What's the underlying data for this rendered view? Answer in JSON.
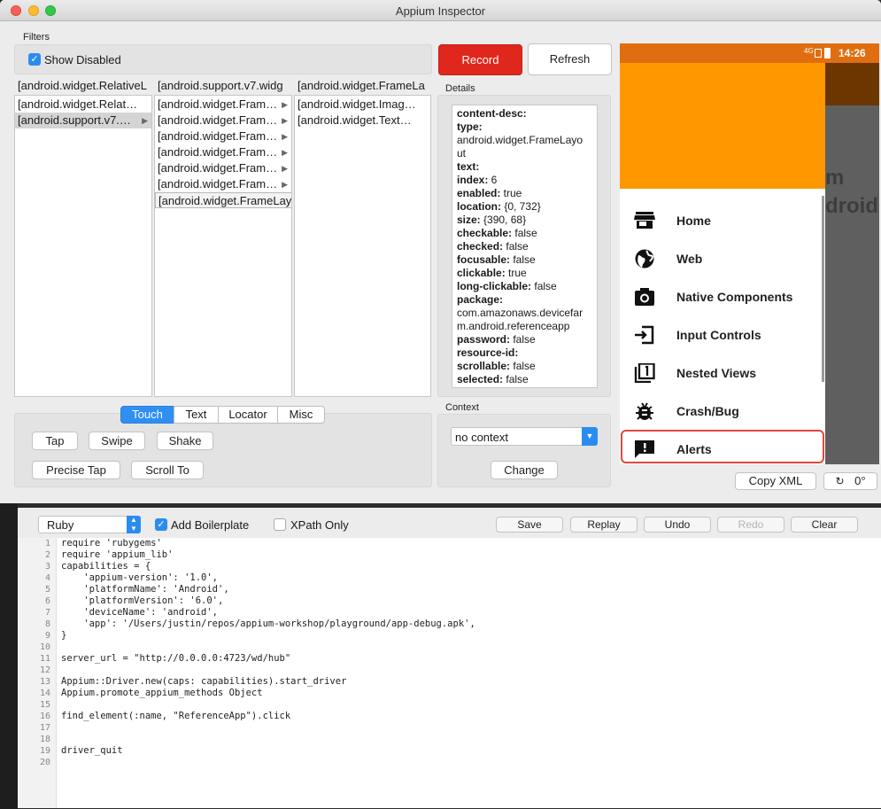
{
  "window": {
    "title": "Appium Inspector"
  },
  "filters": {
    "label": "Filters",
    "show_disabled_label": "Show Disabled"
  },
  "tree": {
    "columns": [
      {
        "header": "[android.widget.RelativeL",
        "items": [
          {
            "label": "[android.widget.Relat…",
            "arrow": false,
            "selected": false
          },
          {
            "label": "[android.support.v7.…",
            "arrow": true,
            "selected": true
          }
        ]
      },
      {
        "header": "[android.support.v7.widg",
        "items": [
          {
            "label": "[android.widget.Fram…",
            "arrow": true
          },
          {
            "label": "[android.widget.Fram…",
            "arrow": true
          },
          {
            "label": "[android.widget.Fram…",
            "arrow": true
          },
          {
            "label": "[android.widget.Fram…",
            "arrow": true
          },
          {
            "label": "[android.widget.Fram…",
            "arrow": true
          },
          {
            "label": "[android.widget.Fram…",
            "arrow": true
          },
          {
            "label": "[android.widget.FrameLayout]",
            "arrow": false,
            "selected": true
          }
        ]
      },
      {
        "header": "[android.widget.FrameLa",
        "items": [
          {
            "label": "[android.widget.Imag…",
            "arrow": false
          },
          {
            "label": "[android.widget.Text…",
            "arrow": false
          }
        ]
      }
    ]
  },
  "toolbar": {
    "record_label": "Record",
    "refresh_label": "Refresh"
  },
  "details": {
    "label": "Details",
    "rows": [
      {
        "key": "content-desc:",
        "value": ""
      },
      {
        "key": "type:",
        "value": ""
      },
      {
        "key": "",
        "value": "android.widget.FrameLayo"
      },
      {
        "key": "",
        "value": "ut"
      },
      {
        "key": "text:",
        "value": ""
      },
      {
        "key": "index:",
        "value": " 6"
      },
      {
        "key": "enabled:",
        "value": " true"
      },
      {
        "key": "location:",
        "value": " {0, 732}"
      },
      {
        "key": "size:",
        "value": " {390, 68}"
      },
      {
        "key": "checkable:",
        "value": " false"
      },
      {
        "key": "checked:",
        "value": " false"
      },
      {
        "key": "focusable:",
        "value": " false"
      },
      {
        "key": "clickable:",
        "value": " true"
      },
      {
        "key": "long-clickable:",
        "value": " false"
      },
      {
        "key": "package:",
        "value": ""
      },
      {
        "key": "",
        "value": "com.amazonaws.devicefar"
      },
      {
        "key": "",
        "value": "m.android.referenceapp"
      },
      {
        "key": "password:",
        "value": " false"
      },
      {
        "key": "resource-id:",
        "value": ""
      },
      {
        "key": "scrollable:",
        "value": " false"
      },
      {
        "key": "selected:",
        "value": " false"
      }
    ]
  },
  "actions": {
    "tabs": [
      "Touch",
      "Text",
      "Locator",
      "Misc"
    ],
    "active_tab": "Touch",
    "tap": "Tap",
    "swipe": "Swipe",
    "shake": "Shake",
    "precise_tap": "Precise Tap",
    "scroll_to": "Scroll To"
  },
  "context": {
    "label": "Context",
    "selected": "no context",
    "change_label": "Change"
  },
  "device": {
    "network": "4G",
    "time": "14:26",
    "menu": [
      "Home",
      "Web",
      "Native Components",
      "Input Controls",
      "Nested Views",
      "Crash/Bug",
      "Alerts"
    ],
    "header_bg": "#ff9800",
    "status_bg": "#e06e10"
  },
  "copy_xml_label": "Copy XML",
  "rotation": "0°",
  "code_toolbar": {
    "language": "Ruby",
    "add_boilerplate_label": "Add Boilerplate",
    "xpath_only_label": "XPath Only",
    "save": "Save",
    "replay": "Replay",
    "undo": "Undo",
    "redo": "Redo",
    "clear": "Clear"
  },
  "code": {
    "line_numbers": [
      "1",
      "2",
      "3",
      "4",
      "5",
      "6",
      "7",
      "8",
      "9",
      "10",
      "11",
      "12",
      "13",
      "14",
      "15",
      "16",
      "17",
      "18",
      "19",
      "20"
    ],
    "lines": [
      "require 'rubygems'",
      "require 'appium_lib'",
      "capabilities = {",
      "    'appium-version': '1.0',",
      "    'platformName': 'Android',",
      "    'platformVersion': '6.0',",
      "    'deviceName': 'android',",
      "    'app': '/Users/justin/repos/appium-workshop/playground/app-debug.apk',",
      "}",
      "",
      "server_url = \"http://0.0.0.0:4723/wd/hub\"",
      "",
      "Appium::Driver.new(caps: capabilities).start_driver",
      "Appium.promote_appium_methods Object",
      "",
      "find_element(:name, \"ReferenceApp\").click",
      "",
      "",
      "driver_quit",
      ""
    ]
  }
}
